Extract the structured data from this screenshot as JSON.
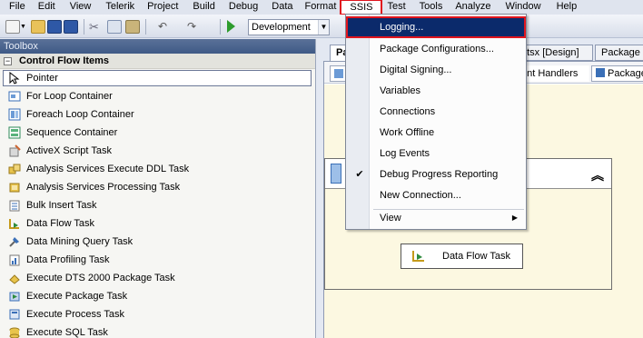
{
  "menubar": {
    "items": [
      "File",
      "Edit",
      "View",
      "Telerik",
      "Project",
      "Build",
      "Debug",
      "Data",
      "Format",
      "SSIS",
      "Test",
      "Tools",
      "Analyze",
      "Window",
      "Help"
    ]
  },
  "toolbar": {
    "configuration": "Development"
  },
  "toolbox": {
    "title": "Toolbox",
    "section_header": "Control Flow Items",
    "items": [
      {
        "label": "Pointer",
        "icon": "pointer-icon"
      },
      {
        "label": "For Loop Container",
        "icon": "for-loop-icon"
      },
      {
        "label": "Foreach Loop Container",
        "icon": "foreach-loop-icon"
      },
      {
        "label": "Sequence Container",
        "icon": "sequence-icon"
      },
      {
        "label": "ActiveX Script Task",
        "icon": "activex-icon"
      },
      {
        "label": "Analysis Services Execute DDL Task",
        "icon": "ddl-icon"
      },
      {
        "label": "Analysis Services Processing Task",
        "icon": "processing-icon"
      },
      {
        "label": "Bulk Insert Task",
        "icon": "bulk-insert-icon"
      },
      {
        "label": "Data Flow Task",
        "icon": "data-flow-icon"
      },
      {
        "label": "Data Mining Query Task",
        "icon": "data-mining-icon"
      },
      {
        "label": "Data Profiling Task",
        "icon": "profiling-icon"
      },
      {
        "label": "Execute DTS 2000 Package Task",
        "icon": "dts-icon"
      },
      {
        "label": "Execute Package Task",
        "icon": "package-icon"
      },
      {
        "label": "Execute Process Task",
        "icon": "process-icon"
      },
      {
        "label": "Execute SQL Task",
        "icon": "sql-icon"
      }
    ]
  },
  "document": {
    "tab_left": "Pa",
    "tab_design": "dtsx [Design]",
    "tab_right": "Package",
    "inner_tab_event_handlers": "ent Handlers",
    "inner_tab_package": "Package",
    "data_flow_task_label": "Data Flow Task"
  },
  "ssis_menu": {
    "items": [
      {
        "label": "Logging...",
        "highlight": true
      },
      {
        "label": "Package Configurations..."
      },
      {
        "label": "Digital Signing..."
      },
      {
        "label": "Variables"
      },
      {
        "label": "Connections"
      },
      {
        "label": "Work Offline"
      },
      {
        "label": "Log Events"
      },
      {
        "label": "Debug Progress Reporting",
        "checked": true
      },
      {
        "label": "New Connection..."
      },
      {
        "label": "View",
        "submenu": true
      }
    ]
  },
  "colors": {
    "highlight_border": "#e0151e",
    "menu_highlight": "#0b2a6b",
    "canvas": "#fcf8e1"
  }
}
